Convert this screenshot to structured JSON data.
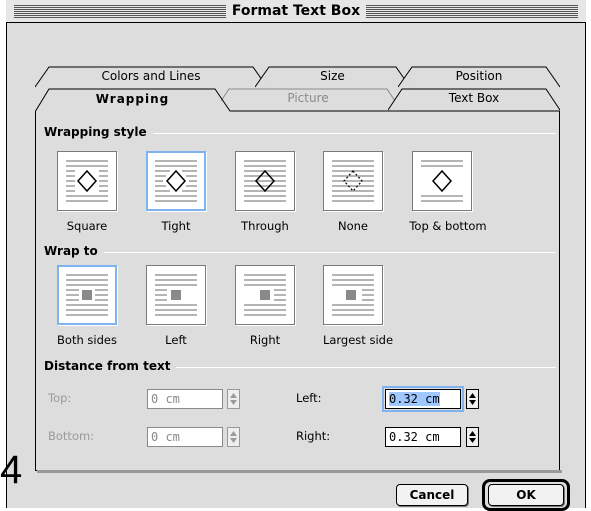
{
  "window": {
    "title": "Format Text Box"
  },
  "tabs": {
    "row1": [
      {
        "label": "Colors and Lines"
      },
      {
        "label": "Size"
      },
      {
        "label": "Position"
      }
    ],
    "row2": [
      {
        "label": "Wrapping",
        "active": true
      },
      {
        "label": "Picture",
        "disabled": true
      },
      {
        "label": "Text Box"
      }
    ]
  },
  "wrapping_style": {
    "heading": "Wrapping style",
    "options": [
      {
        "label": "Square",
        "mnemonic": "q",
        "selected": false
      },
      {
        "label": "Tight",
        "mnemonic": "T",
        "selected": true
      },
      {
        "label": "Through",
        "mnemonic": "h",
        "selected": false
      },
      {
        "label": "None",
        "mnemonic": "N",
        "selected": false
      },
      {
        "label": "Top & bottom",
        "mnemonic": "o",
        "selected": false
      }
    ]
  },
  "wrap_to": {
    "heading": "Wrap to",
    "options": [
      {
        "label": "Both sides",
        "mnemonic": "B",
        "selected": true
      },
      {
        "label": "Left",
        "mnemonic": "L",
        "selected": false
      },
      {
        "label": "Right",
        "mnemonic": "R",
        "selected": false
      },
      {
        "label": "Largest side",
        "mnemonic": "a",
        "selected": false
      }
    ]
  },
  "distance": {
    "heading": "Distance from text",
    "top": {
      "label": "Top:",
      "value": "0 cm",
      "disabled": true
    },
    "bottom": {
      "label": "Bottom:",
      "value": "0 cm",
      "disabled": true
    },
    "left": {
      "label": "Left:",
      "value": "0.32 cm",
      "focused": true
    },
    "right": {
      "label": "Right:",
      "value": "0.32 cm"
    }
  },
  "buttons": {
    "cancel": "Cancel",
    "ok": "OK"
  },
  "stray_text": "4",
  "colors": {
    "selection_ring": "#7fb3ef",
    "panel": "#dddddd"
  }
}
